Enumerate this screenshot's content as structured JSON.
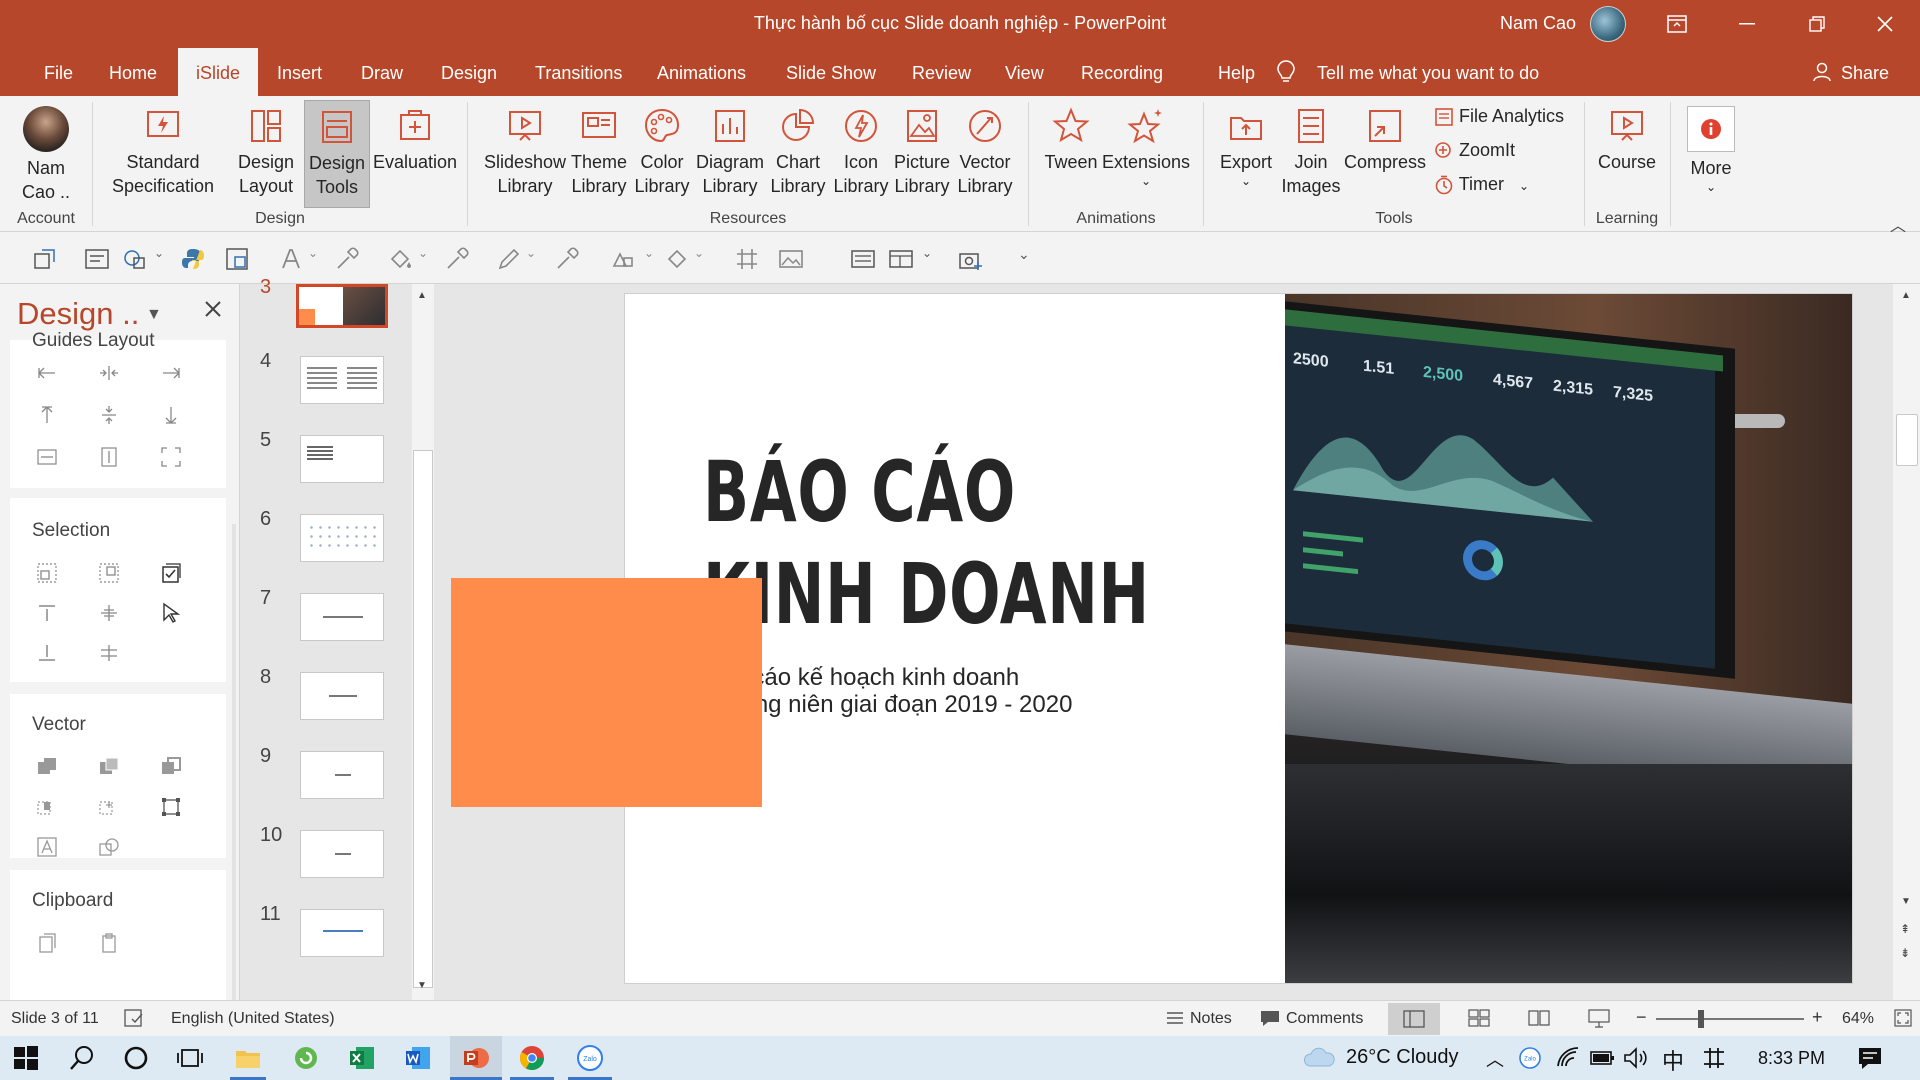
{
  "titlebar": {
    "doc_title": "Thực hành bố cục Slide doanh nghiệp  -  PowerPoint",
    "user_name": "Nam Cao"
  },
  "tabs": [
    "File",
    "Home",
    "iSlide",
    "Insert",
    "Draw",
    "Design",
    "Transitions",
    "Animations",
    "Slide Show",
    "Review",
    "View",
    "Recording",
    "Help"
  ],
  "tell_me": "Tell me what you want to do",
  "share": "Share",
  "ribbon": {
    "account": {
      "line1": "Nam",
      "line2": "Cao ..",
      "group": "Account"
    },
    "design": {
      "group": "Design",
      "items": [
        {
          "l1": "Standard",
          "l2": "Specification"
        },
        {
          "l1": "Design",
          "l2": "Layout"
        },
        {
          "l1": "Design",
          "l2": "Tools"
        },
        {
          "l1": "Evaluation",
          "l2": ""
        }
      ]
    },
    "resources": {
      "group": "Resources",
      "items": [
        {
          "l1": "Slideshow",
          "l2": "Library"
        },
        {
          "l1": "Theme",
          "l2": "Library"
        },
        {
          "l1": "Color",
          "l2": "Library"
        },
        {
          "l1": "Diagram",
          "l2": "Library"
        },
        {
          "l1": "Chart",
          "l2": "Library"
        },
        {
          "l1": "Icon",
          "l2": "Library"
        },
        {
          "l1": "Picture",
          "l2": "Library"
        },
        {
          "l1": "Vector",
          "l2": "Library"
        }
      ]
    },
    "animations": {
      "group": "Animations",
      "items": [
        "Tween",
        "Extensions"
      ]
    },
    "tools": {
      "group": "Tools",
      "items": [
        {
          "l1": "Export",
          "l2": ""
        },
        {
          "l1": "Join",
          "l2": "Images"
        },
        {
          "l1": "Compress",
          "l2": ""
        }
      ],
      "small": [
        "File Analytics",
        "ZoomIt",
        "Timer"
      ]
    },
    "learning": {
      "group": "Learning",
      "items": [
        "Course"
      ]
    },
    "more": "More"
  },
  "panel": {
    "title": "Design ..",
    "sections": [
      "Guides Layout",
      "Selection",
      "Vector",
      "Clipboard"
    ]
  },
  "thumbs": [
    "3",
    "4",
    "5",
    "6",
    "7",
    "8",
    "9",
    "10",
    "11"
  ],
  "slide": {
    "title_line1": "BÁO CÁO",
    "title_line2": "KINH DOANH",
    "sub_line1": "Báo cáo kế hoạch kinh doanh",
    "sub_line2": "thường niên giai đoạn 2019 - 2020",
    "photo_stats": [
      "2500",
      "1.51",
      "2,500",
      "4,567",
      "2,315",
      "7,325"
    ]
  },
  "status": {
    "slide_info": "Slide 3 of 11",
    "language": "English (United States)",
    "notes": "Notes",
    "comments": "Comments",
    "zoom": "64%"
  },
  "taskbar": {
    "weather": "26°C  Cloudy",
    "ime": "中",
    "time": "8:33 PM"
  },
  "colors": {
    "accent": "#b7472a",
    "orange_shape": "#ff8c4b"
  }
}
